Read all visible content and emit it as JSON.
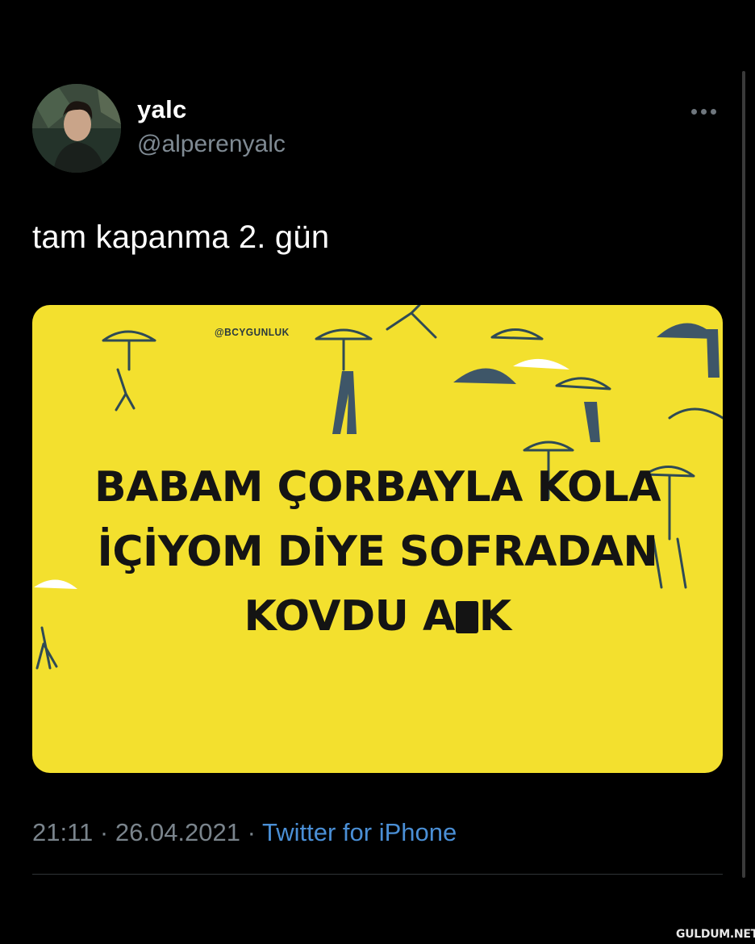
{
  "tweet": {
    "display_name": "yalc",
    "handle": "@alperenyalc",
    "text": "tam kapanma 2. gün",
    "media": {
      "watermark": "@BCYGUNLUK",
      "caption_line1": "BABAM ÇORBAYLA KOLA",
      "caption_line2": "İÇİYOM DİYE SOFRADAN",
      "caption_line3_a": "KOVDU A",
      "caption_line3_b": "K"
    },
    "time": "21:11",
    "separator": "·",
    "date": "26.04.2021",
    "source": "Twitter for iPhone"
  },
  "site_logo": "GULDUM.NET",
  "icons": {
    "more": "more-horizontal-icon",
    "avatar": "profile-photo"
  },
  "colors": {
    "background": "#000000",
    "media_yellow": "#f3e02e",
    "link_blue": "#4a8fd6",
    "muted_gray": "#7a848c"
  }
}
